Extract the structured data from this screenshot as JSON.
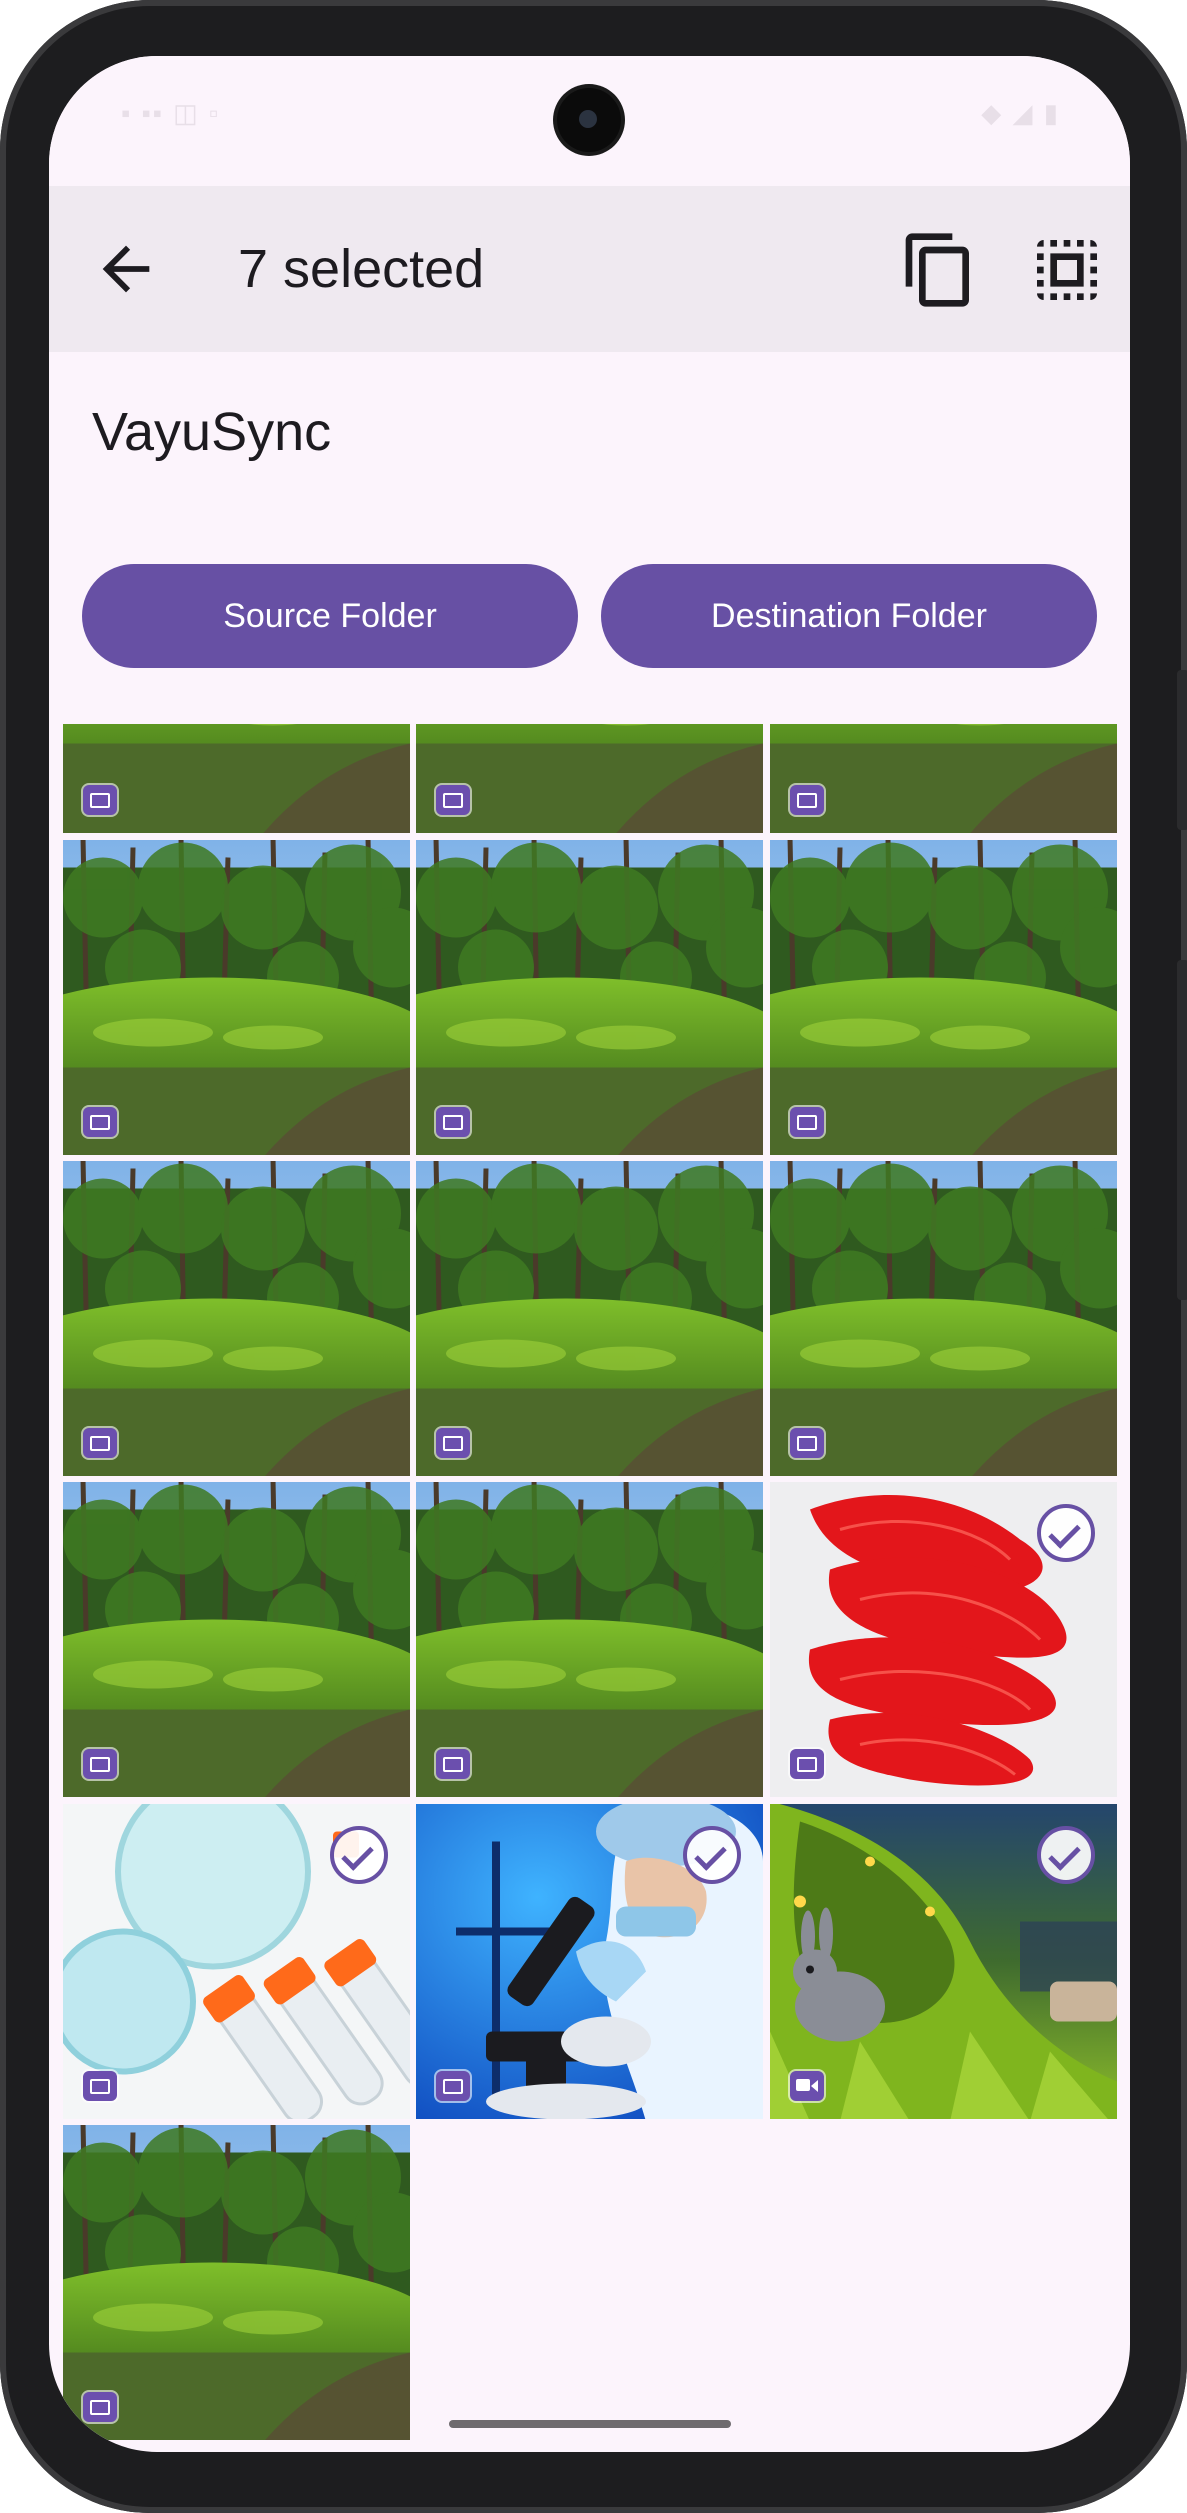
{
  "appbar": {
    "selected_label": "7 selected",
    "back_icon": "arrow-back-icon",
    "copy_icon": "copy-icon",
    "select_all_icon": "select-all-icon"
  },
  "app": {
    "title": "VayuSync"
  },
  "buttons": {
    "source_label": "Source Folder",
    "destination_label": "Destination Folder"
  },
  "colors": {
    "accent": "#6750a4",
    "appbar_bg": "#efe9f0",
    "page_bg": "#fcf4fc"
  },
  "gallery": {
    "items": [
      {
        "image": "forest-clearing",
        "media": "image",
        "selected": false
      },
      {
        "image": "forest-clearing",
        "media": "image",
        "selected": false
      },
      {
        "image": "forest-clearing",
        "media": "image",
        "selected": false
      },
      {
        "image": "forest-clearing",
        "media": "image",
        "selected": false
      },
      {
        "image": "forest-clearing",
        "media": "image",
        "selected": false
      },
      {
        "image": "forest-clearing",
        "media": "image",
        "selected": false
      },
      {
        "image": "forest-clearing",
        "media": "image",
        "selected": false
      },
      {
        "image": "forest-clearing",
        "media": "image",
        "selected": false
      },
      {
        "image": "forest-clearing",
        "media": "image",
        "selected": false
      },
      {
        "image": "forest-clearing",
        "media": "image",
        "selected": false
      },
      {
        "image": "forest-clearing",
        "media": "image",
        "selected": false
      },
      {
        "image": "red-paint-strokes",
        "media": "image",
        "selected": true
      },
      {
        "image": "petri-dishes-test-tubes",
        "media": "image",
        "selected": true
      },
      {
        "image": "scientist-microscope",
        "media": "image",
        "selected": true
      },
      {
        "image": "animated-rabbit-grass",
        "media": "video",
        "selected": true
      },
      {
        "image": "forest-clearing",
        "media": "image",
        "selected": false
      }
    ]
  }
}
